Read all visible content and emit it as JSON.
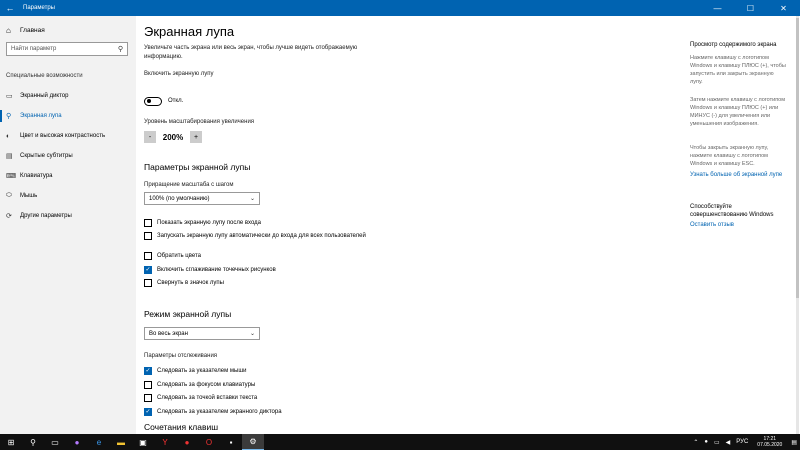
{
  "window": {
    "title": "Параметры",
    "back_glyph": "←",
    "minimize_glyph": "—",
    "maximize_glyph": "☐",
    "close_glyph": "✕"
  },
  "sidebar": {
    "home_label": "Главная",
    "search_placeholder": "Найти параметр",
    "section_label": "Специальные возможности",
    "items": [
      {
        "label": "Экранный диктор",
        "icon": "narrator-icon",
        "glyph": "▭"
      },
      {
        "label": "Экранная лупа",
        "icon": "magnifier-icon",
        "glyph": "⚲",
        "active": true
      },
      {
        "label": "Цвет и высокая контрастность",
        "icon": "contrast-icon",
        "glyph": "◐"
      },
      {
        "label": "Скрытые субтитры",
        "icon": "captions-icon",
        "glyph": "▤"
      },
      {
        "label": "Клавиатура",
        "icon": "keyboard-icon",
        "glyph": "⌨"
      },
      {
        "label": "Мышь",
        "icon": "mouse-icon",
        "glyph": "⬭"
      },
      {
        "label": "Другие параметры",
        "icon": "other-settings-icon",
        "glyph": "⟳"
      }
    ]
  },
  "main": {
    "title": "Экранная лупа",
    "description": "Увеличьте часть экрана или весь экран, чтобы лучше видеть отображаемую информацию.",
    "enable_label": "Включить экранную лупу",
    "toggle_state": "Откл.",
    "zoom_level_label": "Уровень масштабирования увеличения",
    "zoom_minus": "-",
    "zoom_value": "200%",
    "zoom_plus": "+",
    "settings_heading": "Параметры экранной лупы",
    "step_label": "Приращение масштаба с шагом",
    "step_value": "100% (по умолчанию)",
    "options": [
      {
        "label": "Показать экранную лупу после входа",
        "checked": false
      },
      {
        "label": "Запускать экранную лупу автоматически до входа для всех пользователей",
        "checked": false
      },
      {
        "label": "Обратить цвета",
        "checked": false
      },
      {
        "label": "Включить сглаживание точечных рисунков",
        "checked": true
      },
      {
        "label": "Свернуть в значок лупы",
        "checked": false
      }
    ],
    "mode_heading": "Режим экранной лупы",
    "mode_value": "Во весь экран",
    "tracking_label": "Параметры отслеживания",
    "tracking": [
      {
        "label": "Следовать за указателем мыши",
        "checked": true
      },
      {
        "label": "Следовать за фокусом клавиатуры",
        "checked": false
      },
      {
        "label": "Следовать за точкой вставки текста",
        "checked": false
      },
      {
        "label": "Следовать за указателем экранного диктора",
        "checked": true
      }
    ],
    "shortcuts_heading": "Сочетания клавиш"
  },
  "right": {
    "preview_title": "Просмотр содержимого экрана",
    "preview_text1": "Нажмите клавишу с логотипом Windows и клавишу ПЛЮС (+), чтобы запустить или закрыть экранную лупу.",
    "preview_text2": "Затем нажмите клавишу с логотипом Windows и клавишу ПЛЮС (+) или МИНУС (-) для увеличения или уменьшения изображения.",
    "preview_text3": "Чтобы закрыть экранную лупу, нажмите клавишу с логотипом Windows и клавишу ESC.",
    "learn_more_link": "Узнать больше об экранной лупе",
    "feedback_title": "Способствуйте совершенствованию Windows",
    "feedback_link": "Оставить отзыв"
  },
  "taskbar": {
    "lang": "РУС",
    "time": "17:21",
    "date": "07.05.2020"
  },
  "colors": {
    "accent": "#0063b1",
    "sidebar_bg": "#f2f2f2",
    "taskbar_bg": "#101010"
  }
}
